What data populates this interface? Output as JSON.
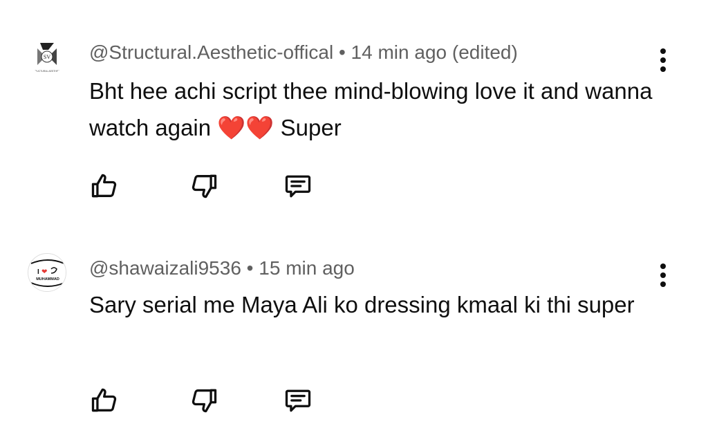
{
  "comments": [
    {
      "author": "@Structural.Aesthetic-offical",
      "separator": "•",
      "time": "14 min ago (edited)",
      "text": "Bht hee achi script thee mind-blowing love it and wanna watch again ❤️❤️ Super",
      "avatar": {
        "monogram": "SV",
        "caption": "STRUCTURAL AESTHETIC"
      }
    },
    {
      "author": "@shawaizali9536",
      "separator": "•",
      "time": "15 min ago",
      "text": "Sary serial me Maya Ali ko dressing kmaal ki thi super",
      "avatar": {
        "top": "I",
        "heart": "❤",
        "name": "MUHAMMAD"
      }
    }
  ],
  "icons": {
    "like": "thumb-up-outline-icon",
    "dislike": "thumb-down-outline-icon",
    "reply": "comment-reply-icon",
    "more": "vertical-dots-icon"
  },
  "colors": {
    "text": "#0f0f0f",
    "meta": "#606060",
    "heart": "#e53935"
  }
}
